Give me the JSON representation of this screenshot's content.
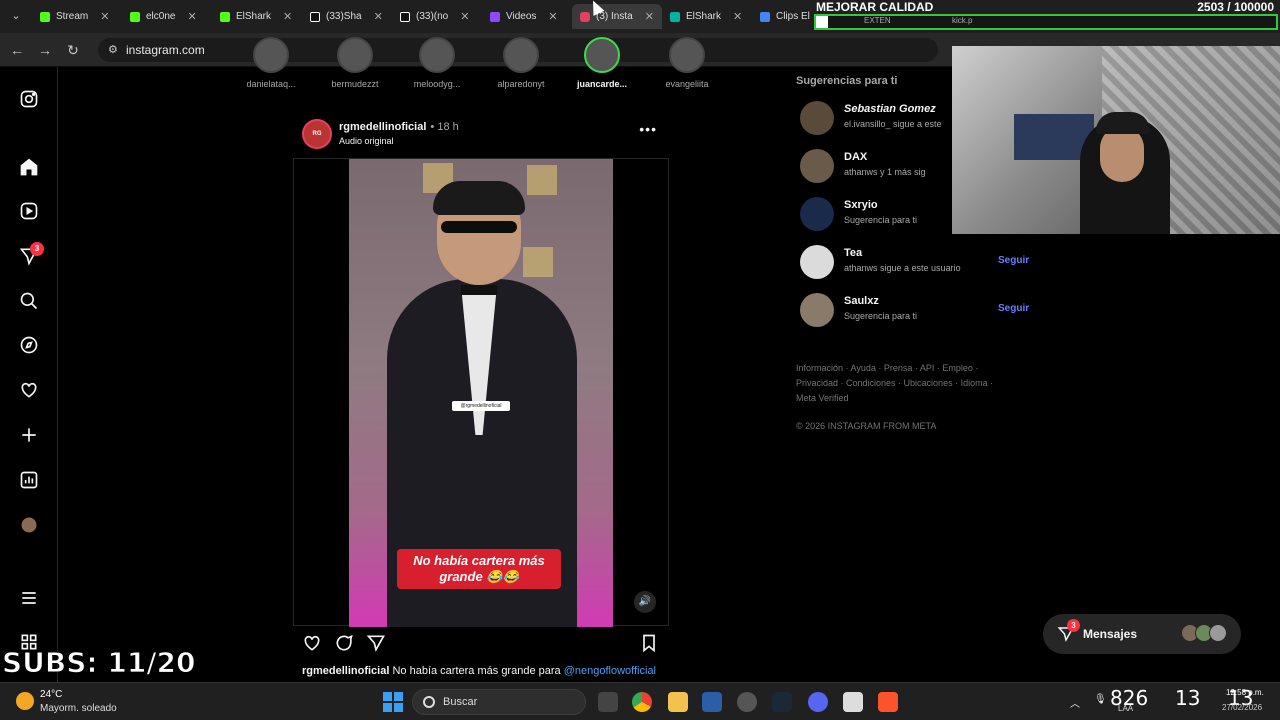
{
  "browser": {
    "tabs": [
      {
        "label": "Stream",
        "color": "#53fc18"
      },
      {
        "label": "elc0ne",
        "color": "#53fc18"
      },
      {
        "label": "ElShark",
        "color": "#53fc18"
      },
      {
        "label": "(33)Sha",
        "color": "#ffffff"
      },
      {
        "label": "(33)(no",
        "color": "#ffffff"
      },
      {
        "label": "Videos",
        "color": "#9146ff"
      },
      {
        "label": "(3) Insta",
        "color": "#e4405f"
      },
      {
        "label": "ElShark",
        "color": "#00b3a4"
      },
      {
        "label": "Clips El",
        "color": "#4285f4"
      }
    ],
    "url": "instagram.com"
  },
  "overlay": {
    "title": "MEJORAR CALIDAD",
    "counter": "2503 / 100000",
    "goal_fraction": 0.025,
    "goal_tab_label": "EXTEN",
    "kick_tab_label": "kick.p",
    "subs": "SUBS: 11/20"
  },
  "stories": [
    {
      "name": "danielataq..."
    },
    {
      "name": "bermudezzt"
    },
    {
      "name": "meloodyg..."
    },
    {
      "name": "alparedonyt"
    },
    {
      "name": "juancarde..."
    },
    {
      "name": "evangeliita"
    }
  ],
  "nav": {
    "notifications_badge": "3"
  },
  "post": {
    "avatar_text": "RG",
    "user": "rgmedellinoficial",
    "time": "• 18 h",
    "audio": "Audio original",
    "video_tag": "@rgmedellinoficial",
    "video_caption": "No había cartera más grande 😂😂",
    "caption_user": "rgmedellinoficial",
    "caption_text": "No había cartera más grande para",
    "caption_mention": "@nengoflowofficial"
  },
  "suggestions": {
    "header": "Sugerencias para ti",
    "items": [
      {
        "name": "Sebastian Gomez",
        "sub": "el.ivansillo_ sigue a este",
        "follow": ""
      },
      {
        "name": "DAX",
        "sub": "athanws y 1 más sig",
        "follow": ""
      },
      {
        "name": "Sxryio",
        "sub": "Sugerencia para ti",
        "follow": ""
      },
      {
        "name": "Tea",
        "sub": "athanws sigue a este usuario",
        "follow": "Seguir"
      },
      {
        "name": "Saulxz",
        "sub": "Sugerencia para ti",
        "follow": "Seguir"
      }
    ],
    "footer_line1": "Información · Ayuda · Prensa · API · Empleo ·",
    "footer_line2": "Privacidad · Condiciones · Ubicaciones · Idioma ·",
    "footer_line3": "Meta Verified",
    "copyright": "© 2026 INSTAGRAM FROM META"
  },
  "messages": {
    "label": "Mensajes",
    "badge": "3"
  },
  "taskbar": {
    "temp": "24°C",
    "weather": "Mayorm. soleado",
    "search": "Buscar",
    "clock_big1": "826",
    "clock_big2": "13",
    "clock_big3": "13",
    "time": "12:58 p.m.",
    "date": "27/02/2026",
    "lang": "LAA"
  }
}
